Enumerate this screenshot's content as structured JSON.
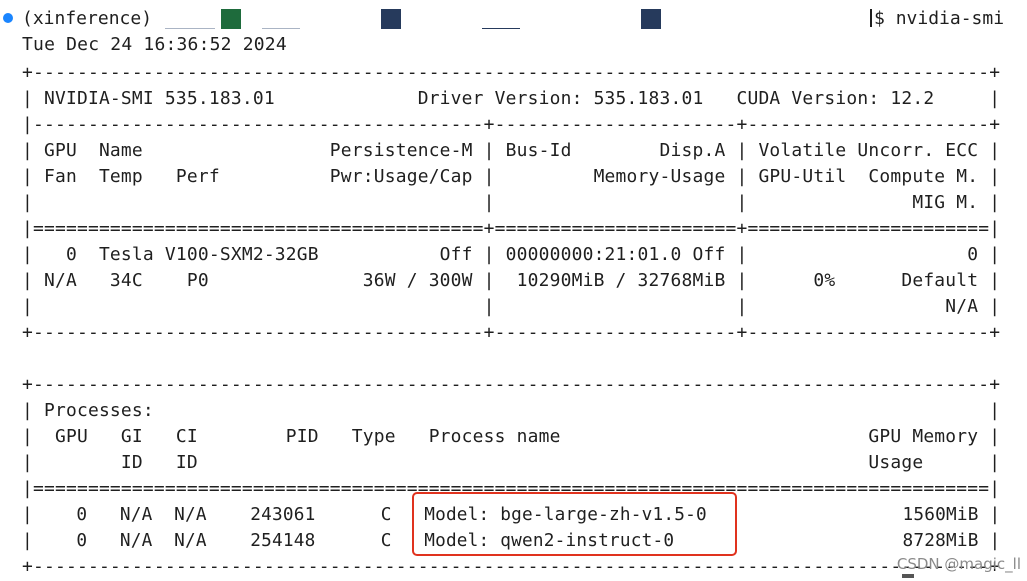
{
  "terminal": {
    "prompt": {
      "env": "(xinference)",
      "command_prefix": "$",
      "command": "nvidia-smi"
    },
    "timestamp": "Tue Dec 24 16:36:52 2024",
    "header": {
      "border_top": "+---------------------------------------------------------------------------------------+",
      "smi_line": "| NVIDIA-SMI 535.183.01             Driver Version: 535.183.01   CUDA Version: 12.2     |",
      "border_mid": "|-----------------------------------------+----------------------+----------------------+",
      "col_line_1": "| GPU  Name                 Persistence-M | Bus-Id        Disp.A | Volatile Uncorr. ECC |",
      "col_line_2": "| Fan  Temp   Perf          Pwr:Usage/Cap |         Memory-Usage | GPU-Util  Compute M. |",
      "col_line_3": "|                                         |                      |               MIG M. |",
      "border_eq": "|=========================================+======================+======================|"
    },
    "gpu": {
      "row_1": "|   0  Tesla V100-SXM2-32GB           Off | 00000000:21:01.0 Off |                    0 |",
      "row_2": "| N/A   34C    P0              36W / 300W |  10290MiB / 32768MiB |      0%      Default |",
      "row_3": "|                                         |                      |                  N/A |",
      "border_bottom": "+-----------------------------------------+----------------------+----------------------+"
    },
    "processes": {
      "border_top": "+---------------------------------------------------------------------------------------+",
      "title_line": "| Processes:                                                                            |",
      "col_line_1": "|  GPU   GI   CI        PID   Type   Process name                            GPU Memory |",
      "col_line_2": "|        ID   ID                                                             Usage      |",
      "border_eq": "|=======================================================================================|",
      "rows": [
        "|    0   N/A  N/A    243061      C   Model: bge-large-zh-v1.5-0                  1560MiB |",
        "|    0   N/A  N/A    254148      C   Model: qwen2-instruct-0                     8728MiB |"
      ],
      "border_bottom": "+---------------------------------------------------------------------------------------+"
    }
  },
  "watermark": "CSDN @magic_ll",
  "colors": {
    "background": "#ffffff",
    "text": "#1f1f1f",
    "prompt_dot": "#1a85ff",
    "highlight": "#e0321e"
  }
}
